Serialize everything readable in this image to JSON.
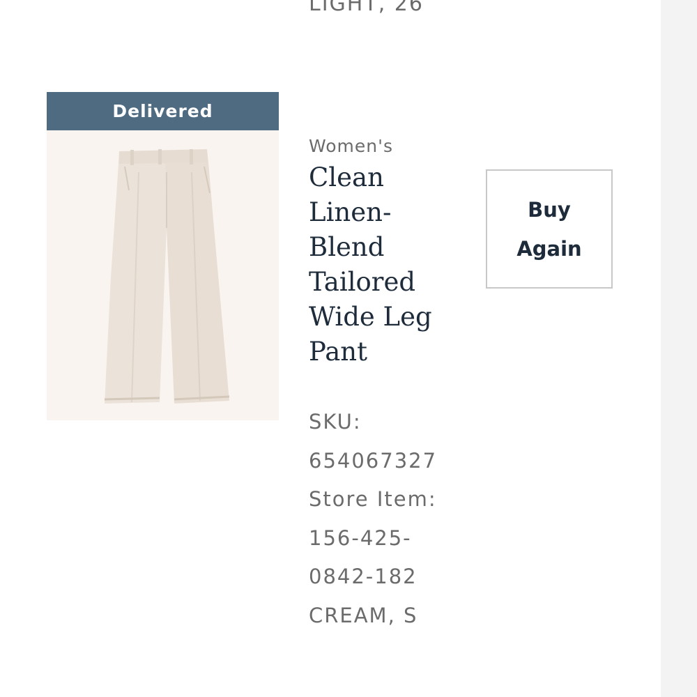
{
  "previous_item": {
    "variant_text": "LIGHT, 26"
  },
  "order_item": {
    "status": "Delivered",
    "image_icon": "wide-leg-pant-image",
    "category": "Women's",
    "name": "Clean Linen-Blend Tailored Wide Leg Pant",
    "sku_label": "SKU:",
    "sku_value": "654067327",
    "store_item_label": "Store Item:",
    "store_item_line1": "156-425-",
    "store_item_line2": "0842-182",
    "variant": "CREAM, S",
    "buy_again_label": "Buy Again"
  },
  "colors": {
    "status_banner": "#4f6b82",
    "product_name": "#1d2b3a",
    "secondary_text": "#6b6b6b",
    "button_border": "#c8c8c8",
    "image_background": "#faf4f1",
    "pant_fabric": "#ebe2d9"
  }
}
